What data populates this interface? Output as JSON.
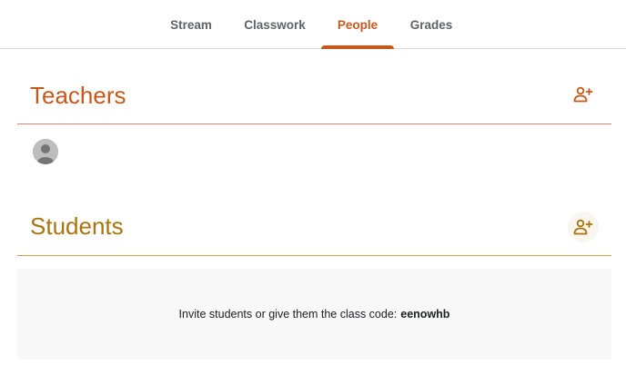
{
  "nav": {
    "tabs": [
      {
        "label": "Stream"
      },
      {
        "label": "Classwork"
      },
      {
        "label": "People",
        "active": true
      },
      {
        "label": "Grades"
      }
    ],
    "accent_color": "#c5591b"
  },
  "teachers": {
    "title": "Teachers",
    "add_icon": "person-add-icon",
    "accent_color": "#c5591b",
    "list": [
      {
        "name": "",
        "avatar": "default-avatar-icon"
      }
    ]
  },
  "students": {
    "title": "Students",
    "add_icon": "person-add-icon",
    "accent_color": "#a8740f",
    "empty_state": {
      "text": "Invite students or give them the class code:",
      "class_code": "eenowhb"
    }
  }
}
